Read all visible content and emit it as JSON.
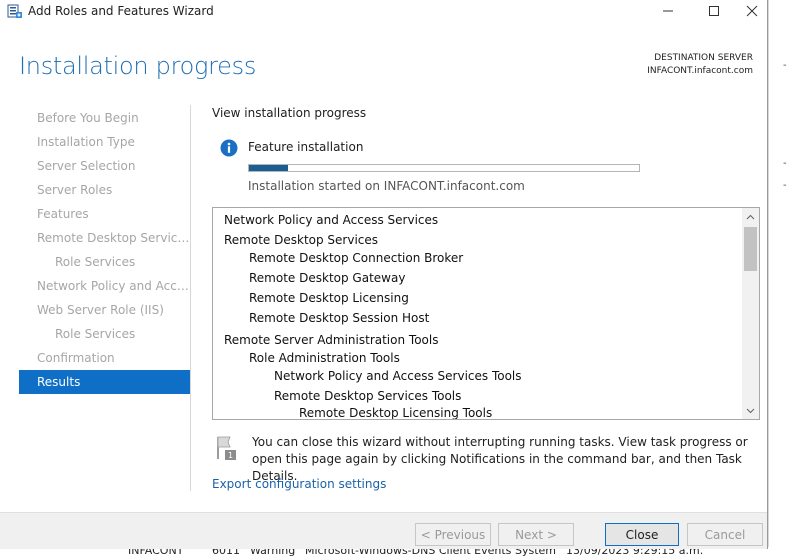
{
  "window": {
    "title": "Add Roles and Features Wizard"
  },
  "header": {
    "page_title": "Installation progress",
    "destination_label": "DESTINATION SERVER",
    "destination_server": "INFACONT.infacont.com"
  },
  "nav": {
    "items": [
      {
        "label": "Before You Begin",
        "sub": false,
        "active": false
      },
      {
        "label": "Installation Type",
        "sub": false,
        "active": false
      },
      {
        "label": "Server Selection",
        "sub": false,
        "active": false
      },
      {
        "label": "Server Roles",
        "sub": false,
        "active": false
      },
      {
        "label": "Features",
        "sub": false,
        "active": false
      },
      {
        "label": "Remote Desktop Services",
        "sub": false,
        "active": false
      },
      {
        "label": "Role Services",
        "sub": true,
        "active": false
      },
      {
        "label": "Network Policy and Acces...",
        "sub": false,
        "active": false
      },
      {
        "label": "Web Server Role (IIS)",
        "sub": false,
        "active": false
      },
      {
        "label": "Role Services",
        "sub": true,
        "active": false
      },
      {
        "label": "Confirmation",
        "sub": false,
        "active": false
      },
      {
        "label": "Results",
        "sub": false,
        "active": true
      }
    ]
  },
  "content": {
    "view_label": "View installation progress",
    "feature_label": "Feature installation",
    "progress_fraction": 0.1,
    "started_text": "Installation started on INFACONT.infacont.com",
    "list": [
      {
        "label": "Network Policy and Access Services",
        "level": 0
      },
      {
        "label": "Remote Desktop Services",
        "level": 0
      },
      {
        "label": "Remote Desktop Connection Broker",
        "level": 1
      },
      {
        "label": "Remote Desktop Gateway",
        "level": 1
      },
      {
        "label": "Remote Desktop Licensing",
        "level": 1
      },
      {
        "label": "Remote Desktop Session Host",
        "level": 1
      },
      {
        "label": "Remote Server Administration Tools",
        "level": 0
      },
      {
        "label": "Role Administration Tools",
        "level": 1
      },
      {
        "label": "Network Policy and Access Services Tools",
        "level": 2
      },
      {
        "label": "Remote Desktop Services Tools",
        "level": 2
      },
      {
        "label": "Remote Desktop Licensing Tools",
        "level": 3
      }
    ],
    "note": "You can close this wizard without interrupting running tasks. View task progress or open this page again by clicking Notifications in the command bar, and then Task Details.",
    "export_link": "Export configuration settings"
  },
  "footer": {
    "previous": "< Previous",
    "next": "Next >",
    "close": "Close",
    "cancel": "Cancel"
  },
  "background": {
    "bottom_fragments": [
      "INFACONT",
      "6011",
      "Warning",
      "Microsoft-Windows-DNS Client Events",
      "System",
      "13/09/2023 9:29:15 a.m."
    ]
  },
  "colors": {
    "accent": "#0f6fc6",
    "title_blue": "#1f6fb5",
    "progress": "#1a5e93",
    "link": "#1a62a8"
  },
  "icons": [
    "server-manager-icon",
    "minimize-icon",
    "maximize-icon",
    "close-icon",
    "info-icon",
    "flag-icon",
    "scroll-up-icon",
    "scroll-down-icon"
  ]
}
